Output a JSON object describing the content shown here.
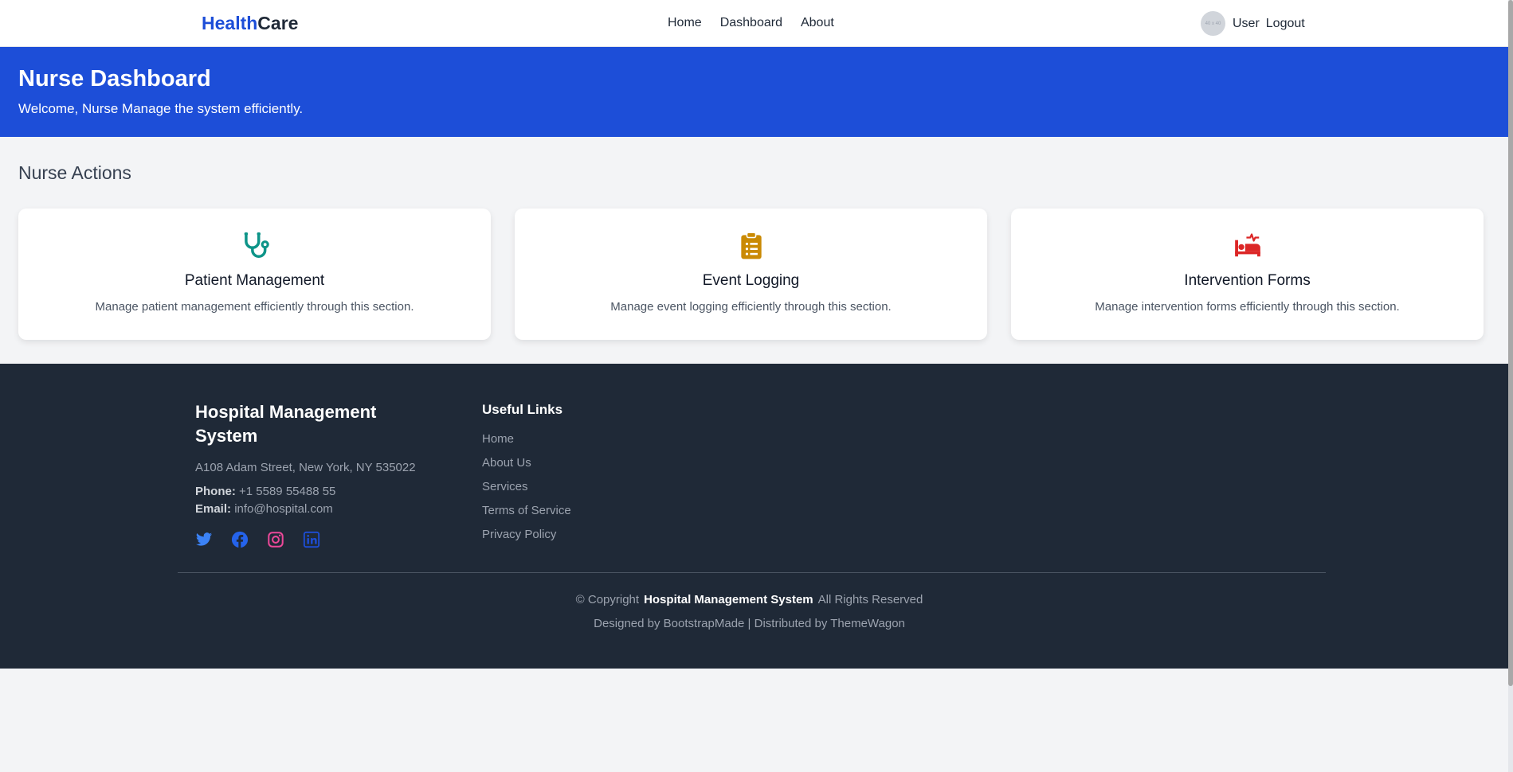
{
  "navbar": {
    "brand_part1": "Health",
    "brand_part2": "Care",
    "links": [
      "Home",
      "Dashboard",
      "About"
    ],
    "avatar_alt": "40 x 40",
    "user_label": "User",
    "logout_label": "Logout"
  },
  "hero": {
    "title": "Nurse Dashboard",
    "subtitle": "Welcome, Nurse Manage the system efficiently."
  },
  "actions": {
    "title": "Nurse Actions",
    "cards": [
      {
        "icon": "stethoscope-icon",
        "color": "#0d9488",
        "title": "Patient Management",
        "desc": "Manage patient management efficiently through this section."
      },
      {
        "icon": "clipboard-list-icon",
        "color": "#ca8a04",
        "title": "Event Logging",
        "desc": "Manage event logging efficiently through this section."
      },
      {
        "icon": "hospital-bed-icon",
        "color": "#dc2626",
        "title": "Intervention Forms",
        "desc": "Manage intervention forms efficiently through this section."
      }
    ]
  },
  "footer": {
    "title": "Hospital Management System",
    "address": "A108 Adam Street, New York, NY 535022",
    "phone_label": "Phone:",
    "phone": "+1 5589 55488 55",
    "email_label": "Email:",
    "email": "info@hospital.com",
    "socials": [
      {
        "icon": "twitter-icon",
        "color": "#3b82f6"
      },
      {
        "icon": "facebook-icon",
        "color": "#2563eb"
      },
      {
        "icon": "instagram-icon",
        "color": "#ec4899"
      },
      {
        "icon": "linkedin-icon",
        "color": "#1d4ed8"
      }
    ],
    "links_title": "Useful Links",
    "links": [
      "Home",
      "About Us",
      "Services",
      "Terms of Service",
      "Privacy Policy"
    ],
    "copyright_prefix": "© Copyright",
    "copyright_name": "Hospital Management System",
    "copyright_suffix": "All Rights Reserved",
    "credits": "Designed by BootstrapMade | Distributed by ThemeWagon"
  },
  "colors": {
    "primary": "#1d4ed8",
    "footer_bg": "#1f2937",
    "page_bg": "#f3f4f6"
  }
}
